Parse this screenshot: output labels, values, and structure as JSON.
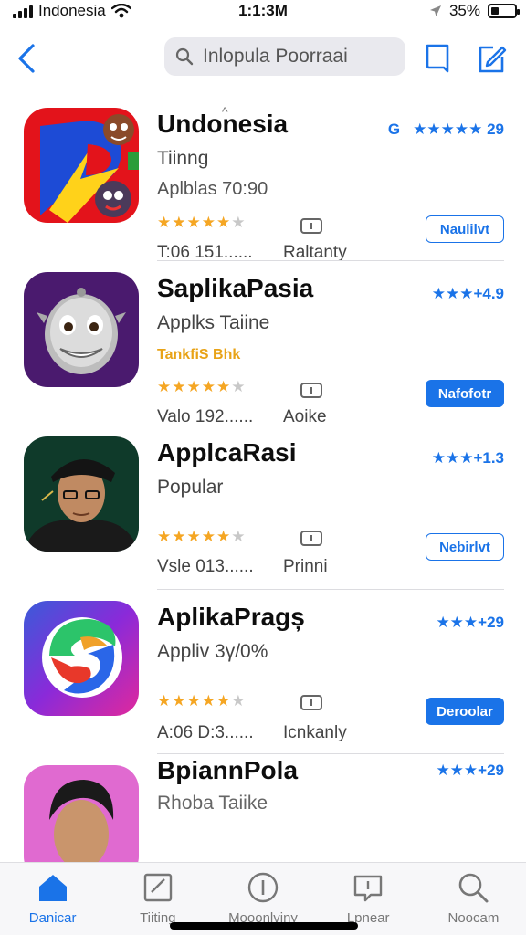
{
  "status_bar": {
    "carrier": "Indonesia",
    "time": "1:1:3M",
    "battery": "35%",
    "battery_level": 0.35
  },
  "search": {
    "placeholder": "Inlopula Poorraai"
  },
  "apps": [
    {
      "name": "Undonesia",
      "subtitle": "Tiinng",
      "subtitle2": "Aplblas 70:90",
      "subtitle2_accent": false,
      "rating": "★★★★★ 29",
      "rating_prefix": "G",
      "stars": 4.5,
      "meta": "T:06 151......",
      "meta_label": "Raltanty",
      "button": "Naulilvt",
      "button_style": "outline",
      "icon": "colorful-p-icon"
    },
    {
      "name": "SaplikaPasia",
      "subtitle": "Applks Taiine",
      "subtitle2": "TankfiS Bhk",
      "subtitle2_accent": true,
      "rating": "★★★+4.9",
      "stars": 4.5,
      "meta": "Valo 192......",
      "meta_label": "Aoike",
      "button": "Nafofotr",
      "button_style": "filled",
      "icon": "robot-face-icon"
    },
    {
      "name": "ApplcaRasi",
      "subtitle": "Popular",
      "stars": 4.5,
      "rating": "★★★+1.3",
      "meta": "Vsle 013......",
      "meta_label": "Prinni",
      "button": "Nebirlvt",
      "button_style": "outline",
      "icon": "man-portrait-icon"
    },
    {
      "name": "AplikaPragș",
      "subtitle": "Appliv 3γ/0%",
      "stars": 4.5,
      "rating": "★★★+29",
      "meta": "A:06 D:3......",
      "meta_label": "Icnkanly",
      "button": "Deroolar",
      "button_style": "filled",
      "icon": "swirl-s-icon"
    },
    {
      "name": "BpiannPola",
      "subtitle": "Rhoba Taiike",
      "rating": "★★★+29",
      "icon": "face-portrait-icon"
    }
  ],
  "tabs": [
    {
      "label": "Danicar",
      "icon": "home-icon",
      "active": true
    },
    {
      "label": "Tiiting",
      "icon": "note-icon",
      "active": false
    },
    {
      "label": "Mooonlviny",
      "icon": "info-icon",
      "active": false
    },
    {
      "label": "Lpnear",
      "icon": "chat-icon",
      "active": false
    },
    {
      "label": "Noocam",
      "icon": "search-icon",
      "active": false
    }
  ],
  "colors": {
    "accent": "#1a73e8",
    "star": "#f5a623"
  }
}
